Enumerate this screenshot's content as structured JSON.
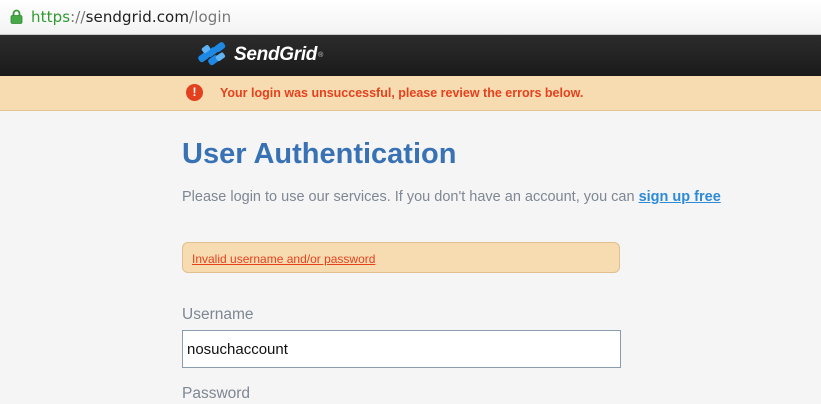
{
  "browser": {
    "url_scheme": "https",
    "url_separator": "://",
    "url_host": "sendgrid.com",
    "url_path": "/login",
    "lock_icon": "lock-icon"
  },
  "header": {
    "brand": "SendGrid",
    "trademark": "®",
    "logo_icon": "sendgrid-logo-icon",
    "bg_color": "#1f1f1f"
  },
  "alert": {
    "icon": "exclamation-icon",
    "icon_text": "!",
    "message": "Your login was unsuccessful, please review the errors below.",
    "color": "#e5411d",
    "bg_color": "#f7dcb2"
  },
  "main": {
    "title": "User Authentication",
    "intro_text": "Please login to use our services. If you don't have an account, you can ",
    "signup_link": "sign up free",
    "error_text": "Invalid username and/or password",
    "username_label": "Username",
    "username_value": "nosuchaccount",
    "password_label": "Password",
    "title_color": "#3872b4",
    "link_color": "#2d8ad6"
  }
}
